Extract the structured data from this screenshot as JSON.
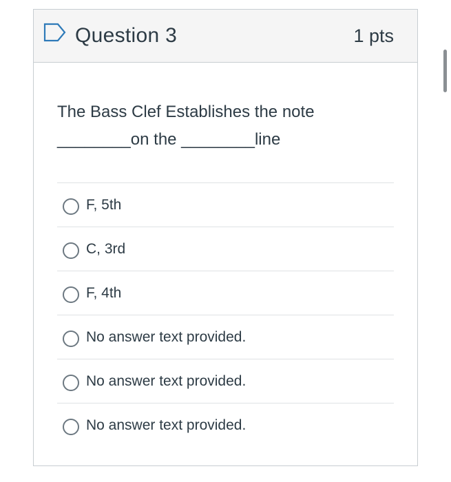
{
  "question": {
    "title": "Question 3",
    "points": "1 pts",
    "text": "The Bass Clef Establishes the note ________on the ________line",
    "flag_icon": "flag-outline-icon",
    "answers": [
      {
        "label": "F, 5th",
        "selected": false
      },
      {
        "label": "C, 3rd",
        "selected": false
      },
      {
        "label": "F, 4th",
        "selected": false
      },
      {
        "label": "No answer text provided.",
        "selected": false
      },
      {
        "label": "No answer text provided.",
        "selected": false
      },
      {
        "label": "No answer text provided.",
        "selected": false
      }
    ]
  },
  "colors": {
    "header_bg": "#f5f5f5",
    "border": "#c7cdd1",
    "divider": "#dfe2e4",
    "text": "#2d3b45",
    "flag": "#2d7ab8"
  }
}
